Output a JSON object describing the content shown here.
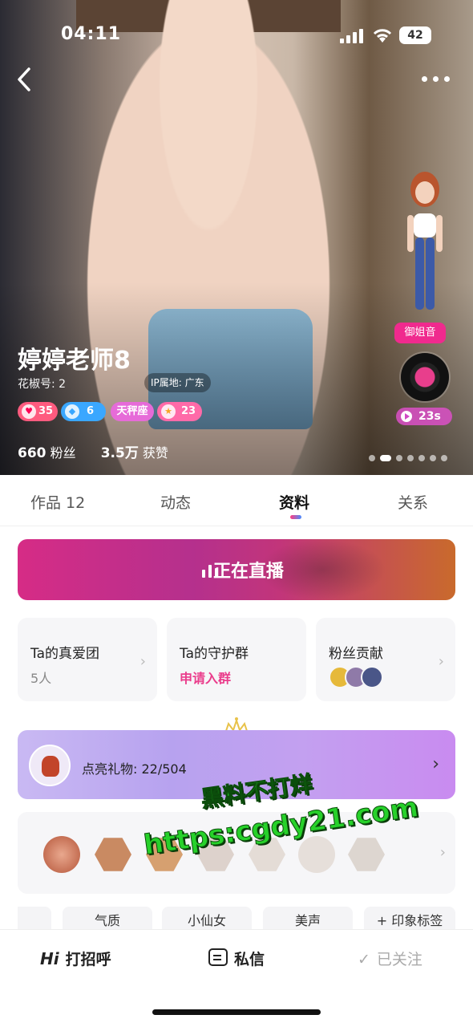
{
  "status_bar": {
    "time": "04:11",
    "battery": "42"
  },
  "profile": {
    "name": "婷婷老师8",
    "id_label": "花椒号: 2",
    "ip_location": "IP属地: 广东",
    "badges": [
      {
        "label": "35",
        "color": "#ff5b7f"
      },
      {
        "label": "6",
        "color": "#3aa7ff"
      },
      {
        "label": "天秤座",
        "color": "#e66bd8"
      },
      {
        "label": "23",
        "color": "#ff6aa8"
      }
    ],
    "fans_count": "660",
    "fans_label": "粉丝",
    "likes_count": "3.5万",
    "likes_label": "获赞",
    "voice_tag": "御姐音",
    "voice_duration": "23s"
  },
  "tabs": [
    {
      "label": "作品 12"
    },
    {
      "label": "动态"
    },
    {
      "label": "资料"
    },
    {
      "label": "关系"
    }
  ],
  "live": {
    "label": "正在直播"
  },
  "cards": {
    "true_love": {
      "title": "Ta的真爱团",
      "sub": "5人"
    },
    "guard": {
      "title": "Ta的守护群",
      "sub": "申请入群"
    },
    "fans": {
      "title": "粉丝贡献"
    }
  },
  "gifts": {
    "label": "点亮礼物: 22/504"
  },
  "tags": [
    "",
    "气质",
    "小仙女",
    "美声",
    "+ 印象标签"
  ],
  "watermark": {
    "line1": "黑料不打烊",
    "line2": "https:cgdy21.com"
  },
  "bottom_bar": {
    "hi": "Hi",
    "greet": "打招呼",
    "message": "私信",
    "followed": "已关注"
  }
}
